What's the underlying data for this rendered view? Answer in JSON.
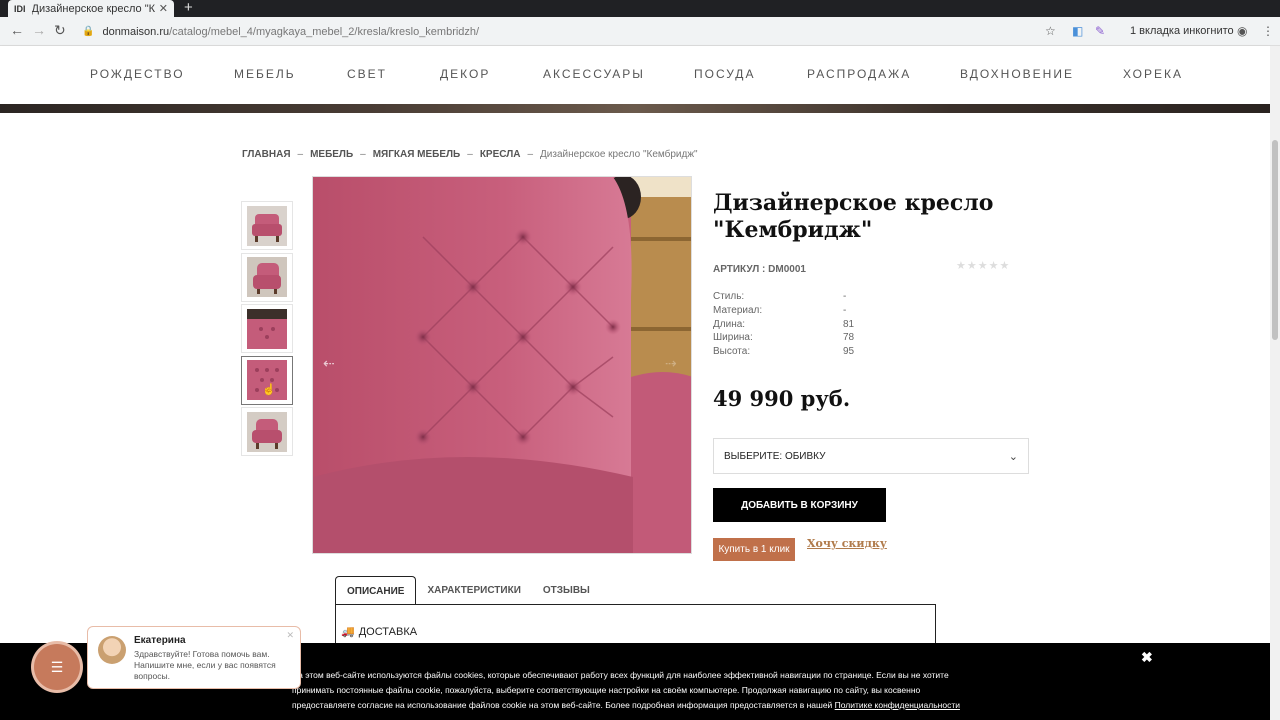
{
  "browser": {
    "tab_title": "Дизайнерское кресло \"К",
    "tab_favicon": "IDI",
    "url_domain": "donmaison.ru",
    "url_path": "/catalog/mebel_4/myagkaya_mebel_2/kresla/kreslo_kembridzh/",
    "incognito_label": "1 вкладка инкогнито"
  },
  "nav": {
    "items": [
      "РОЖДЕСТВО",
      "МЕБЕЛЬ",
      "СВЕТ",
      "ДЕКОР",
      "АКСЕССУАРЫ",
      "ПОСУДА",
      "РАСПРОДАЖА",
      "ВДОХНОВЕНИЕ",
      "ХОРЕКА"
    ]
  },
  "breadcrumb": {
    "items": [
      "ГЛАВНАЯ",
      "МЕБЕЛЬ",
      "МЯГКАЯ МЕБЕЛЬ",
      "КРЕСЛА"
    ],
    "separator": "–",
    "current": "Дизайнерское кресло \"Кембридж\""
  },
  "product": {
    "title": "Дизайнерское кресло \"Кембридж\"",
    "sku_label": "АРТИКУЛ : DM0001",
    "rating_stars": "★★★★★",
    "properties": [
      {
        "key": "Стиль:",
        "value": "-"
      },
      {
        "key": "Материал:",
        "value": "-"
      },
      {
        "key": "Длина:",
        "value": "81"
      },
      {
        "key": "Ширина:",
        "value": "78"
      },
      {
        "key": "Высота:",
        "value": "95"
      }
    ],
    "price": "49 990 руб.",
    "select_label": "ВЫБЕРИТЕ: ОБИВКУ",
    "add_to_cart": "ДОБАВИТЬ В КОРЗИНУ",
    "one_click": "Купить в 1 клик",
    "discount": "Хочу скидку",
    "accent_color": "#c0704a",
    "upholstery_color": "#c45c7a"
  },
  "tabs": {
    "items": [
      "ОПИСАНИЕ",
      "ХАРАКТЕРИСТИКИ",
      "ОТЗЫВЫ"
    ],
    "active": "ОПИСАНИЕ",
    "delivery_heading": "ДОСТАВКА"
  },
  "chat": {
    "name": "Екатерина",
    "message": "Здравствуйте! Готова помочь вам. Напишите мне, если у вас появятся вопросы."
  },
  "cookie": {
    "text": "На этом веб-сайте используются файлы cookies, которые обеспечивают работу всех функций для наиболее эффективной навигации по странице. Если вы не хотите принимать постоянные файлы cookie, пожалуйста, выберите соответствующие настройки на своём компьютере. Продолжая навигацию по сайту, вы косвенно предоставляете согласие на использование файлов cookie на этом веб-сайте. Более подробная информация предоставляется в нашей ",
    "link": "Политике конфиденциальности"
  }
}
